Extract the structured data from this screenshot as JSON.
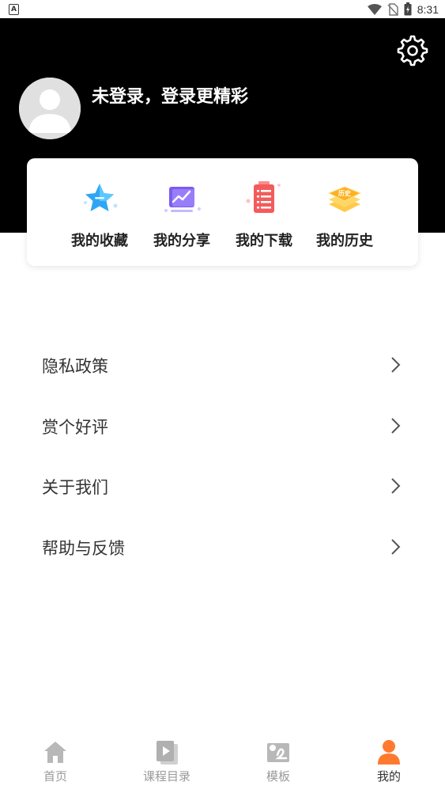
{
  "status_bar": {
    "time": "8:31",
    "left_icon": "A"
  },
  "header": {
    "login_prompt": "未登录，登录更精彩",
    "settings_icon": "gear-icon",
    "bg_color": "#000000"
  },
  "quick_actions": [
    {
      "label": "我的收藏",
      "icon": "star-icon"
    },
    {
      "label": "我的分享",
      "icon": "share-chart-icon"
    },
    {
      "label": "我的下载",
      "icon": "download-list-icon"
    },
    {
      "label": "我的历史",
      "icon": "history-icon",
      "icon_text": "历史"
    }
  ],
  "menu": [
    {
      "label": "隐私政策"
    },
    {
      "label": "赏个好评"
    },
    {
      "label": "关于我们"
    },
    {
      "label": "帮助与反馈"
    }
  ],
  "tabbar": {
    "items": [
      {
        "label": "首页",
        "icon": "home-icon"
      },
      {
        "label": "课程目录",
        "icon": "course-catalog-icon"
      },
      {
        "label": "模板",
        "icon": "template-icon"
      },
      {
        "label": "我的",
        "icon": "profile-icon"
      }
    ],
    "active_index": 3,
    "active_color": "#ff7a2f"
  }
}
